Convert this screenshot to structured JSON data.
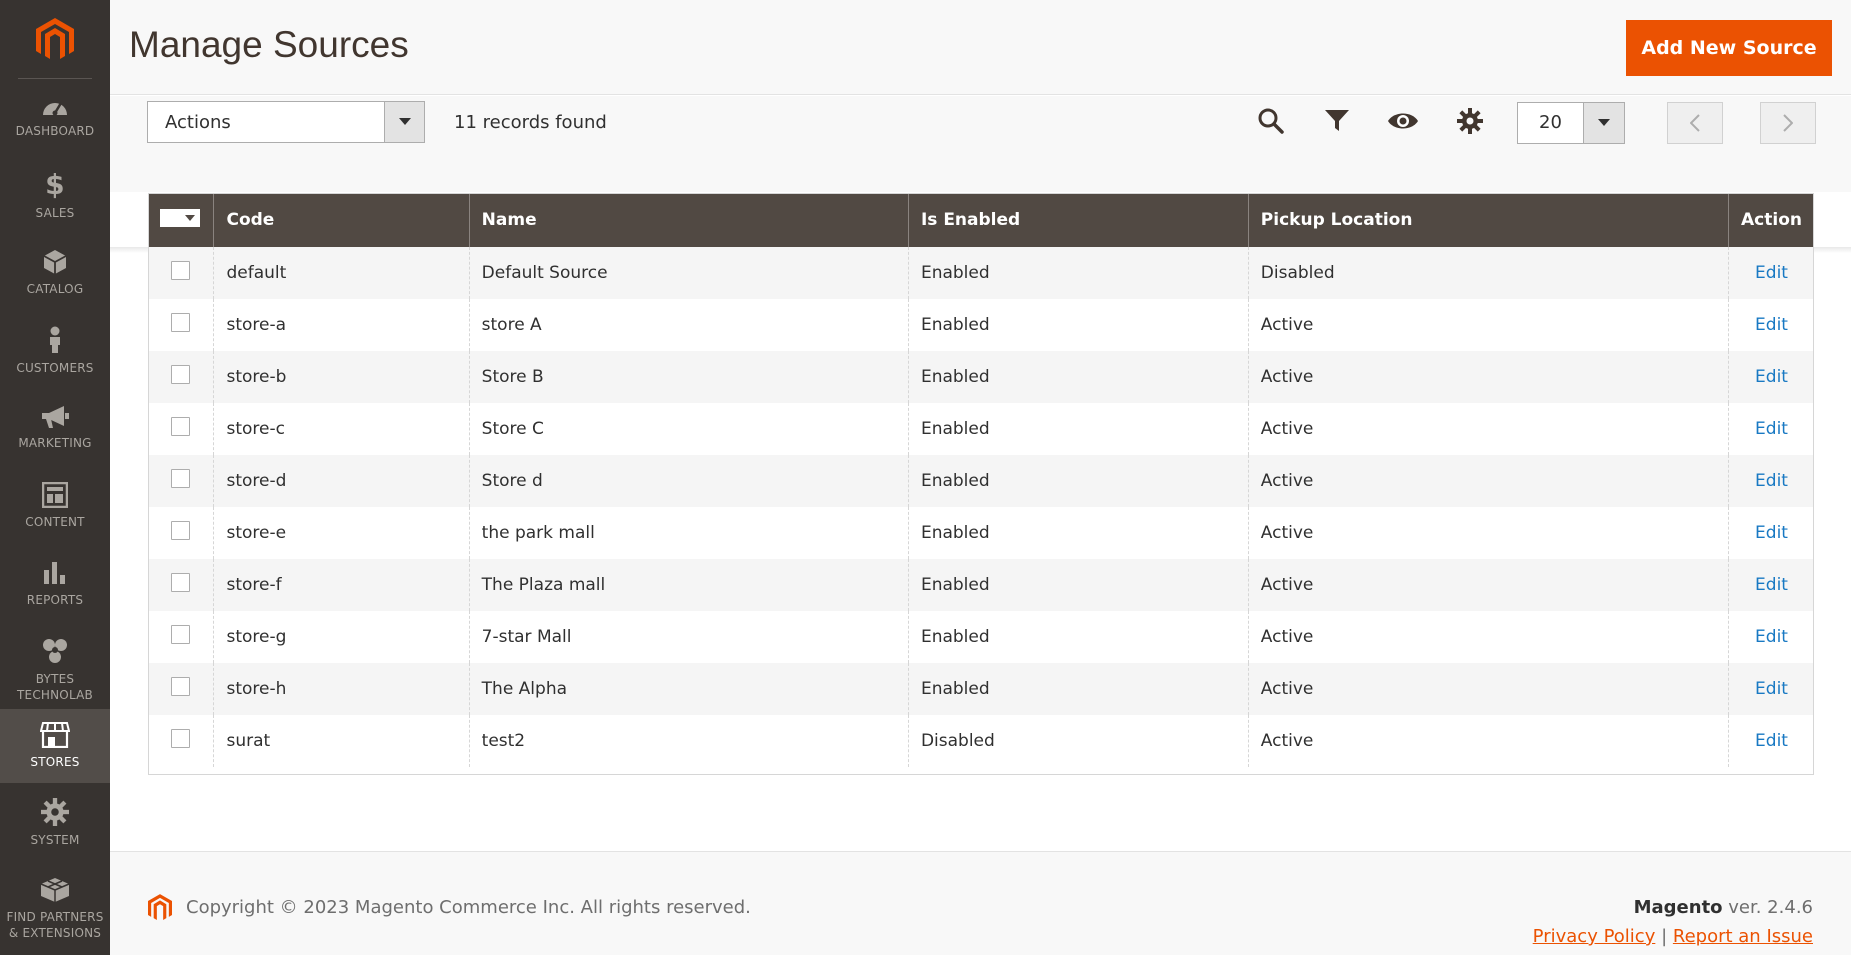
{
  "app": {
    "title": "Manage Sources",
    "accent_color": "#eb5202",
    "sidebar_color": "#373330",
    "grid_header_color": "#514943",
    "link_color": "#1979c3"
  },
  "sidebar": {
    "items": [
      {
        "label": "DASHBOARD",
        "icon": "dashboard-icon"
      },
      {
        "label": "SALES",
        "icon": "dollar-icon"
      },
      {
        "label": "CATALOG",
        "icon": "cube-icon"
      },
      {
        "label": "CUSTOMERS",
        "icon": "person-icon"
      },
      {
        "label": "MARKETING",
        "icon": "megaphone-icon"
      },
      {
        "label": "CONTENT",
        "icon": "layout-icon"
      },
      {
        "label": "REPORTS",
        "icon": "bar-chart-icon"
      },
      {
        "label": "BYTES\nTECHNOLAB",
        "icon": "recycle-icon"
      },
      {
        "label": "STORES",
        "icon": "storefront-icon",
        "active": true
      },
      {
        "label": "SYSTEM",
        "icon": "gear-icon"
      },
      {
        "label": "FIND PARTNERS\n& EXTENSIONS",
        "icon": "blocks-icon"
      }
    ]
  },
  "header": {
    "add_button": "Add New Source"
  },
  "toolbar": {
    "actions_label": "Actions",
    "records_found": "11 records found",
    "per_page": "20"
  },
  "grid": {
    "columns": [
      "Code",
      "Name",
      "Is Enabled",
      "Pickup Location",
      "Action"
    ],
    "rows": [
      {
        "code": "default",
        "name": "Default Source",
        "enabled": "Enabled",
        "pickup": "Disabled",
        "action": "Edit"
      },
      {
        "code": "store-a",
        "name": "store A",
        "enabled": "Enabled",
        "pickup": "Active",
        "action": "Edit"
      },
      {
        "code": "store-b",
        "name": "Store B",
        "enabled": "Enabled",
        "pickup": "Active",
        "action": "Edit"
      },
      {
        "code": "store-c",
        "name": "Store C",
        "enabled": "Enabled",
        "pickup": "Active",
        "action": "Edit"
      },
      {
        "code": "store-d",
        "name": "Store d",
        "enabled": "Enabled",
        "pickup": "Active",
        "action": "Edit"
      },
      {
        "code": "store-e",
        "name": "the park mall",
        "enabled": "Enabled",
        "pickup": "Active",
        "action": "Edit"
      },
      {
        "code": "store-f",
        "name": "The Plaza mall",
        "enabled": "Enabled",
        "pickup": "Active",
        "action": "Edit"
      },
      {
        "code": "store-g",
        "name": "7-star Mall",
        "enabled": "Enabled",
        "pickup": "Active",
        "action": "Edit"
      },
      {
        "code": "store-h",
        "name": "The Alpha",
        "enabled": "Enabled",
        "pickup": "Active",
        "action": "Edit"
      },
      {
        "code": "surat",
        "name": "test2",
        "enabled": "Disabled",
        "pickup": "Active",
        "action": "Edit"
      }
    ]
  },
  "footer": {
    "copyright": "Copyright © 2023 Magento Commerce Inc. All rights reserved.",
    "brand": "Magento",
    "version": " ver. 2.4.6",
    "privacy": "Privacy Policy",
    "separator": "|",
    "report": "Report an Issue"
  }
}
